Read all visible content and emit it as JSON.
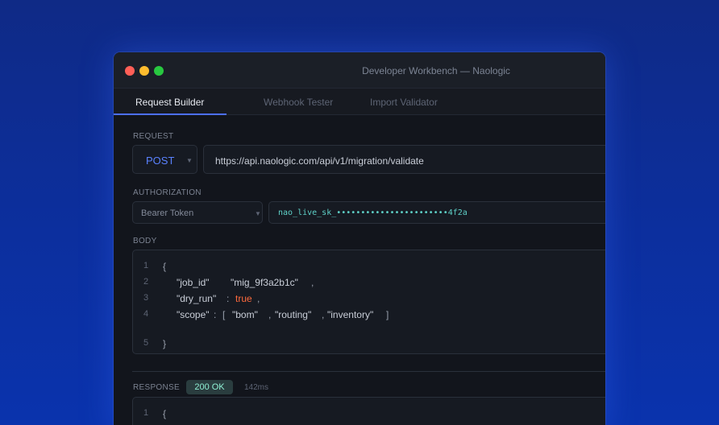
{
  "window": {
    "title": "Developer Workbench — Naologic"
  },
  "tabs": [
    {
      "label": "Request Builder",
      "active": true
    },
    {
      "label": "Webhook Tester",
      "active": false
    },
    {
      "label": "Import Validator",
      "active": false
    }
  ],
  "request": {
    "section_label": "REQUEST",
    "method": "POST",
    "url": "https://api.naologic.com/api/v1/migration/validate"
  },
  "authorization": {
    "section_label": "AUTHORIZATION",
    "type": "Bearer Token",
    "token": "nao_live_sk_•••••••••••••••••••••••4f2a"
  },
  "body": {
    "section_label": "BODY",
    "line_numbers": [
      "1",
      "2",
      "3",
      "4",
      "5"
    ],
    "brace_open": "{",
    "brace_close": "}",
    "key_job_id": "\"job_id\"",
    "val_job_id": "\"mig_9f3a2b1c\"",
    "key_dry_run": "\"dry_run\"",
    "val_dry_run": "true",
    "key_scope": "\"scope\"",
    "scope_items": [
      "\"bom\"",
      "\"routing\"",
      "\"inventory\""
    ],
    "colon": ":",
    "comma": ",",
    "bracket_open": "[",
    "bracket_close": "]"
  },
  "response": {
    "section_label": "RESPONSE",
    "status": "200 OK",
    "timing": "142ms",
    "line_numbers": [
      "1"
    ],
    "brace_open": "{"
  },
  "colors": {
    "accent": "#4c6fff",
    "method": "#5a82ff",
    "token": "#5fd1c8",
    "boolean": "#ff6a3d",
    "status_ok": "#8ff0d4"
  }
}
